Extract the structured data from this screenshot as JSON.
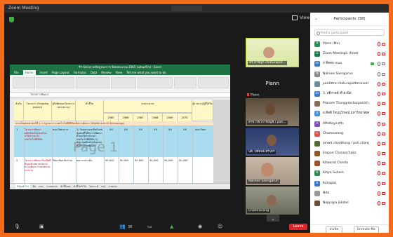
{
  "window": {
    "title": "Zoom Meeting"
  },
  "view": {
    "label": "View"
  },
  "excel": {
    "title": "รีวิวโครงการเชิงบูรณาการ ปีงบประมาณ 2565 (ฉบับแก้ไข) - Excel",
    "tabs": [
      "File",
      "Home",
      "Insert",
      "Page Layout",
      "Formulas",
      "Data",
      "Review",
      "View",
      "Tell me what you want to do"
    ],
    "active_tab": "Home",
    "formula": {
      "cell": "",
      "value": "โครงการพัฒนา"
    },
    "headers": [
      "ลำดับ",
      "โครงการ (Flagship project)",
      "ผู้รับผิดชอบโครงการ (หน่วยงาน)",
      "ตัวชี้วัด",
      "งบประมาณ",
      "ผู้รายงาน/ผู้ที่ได้รับ"
    ],
    "years": [
      "2565",
      "2566",
      "2567",
      "2568",
      "2569",
      "2570"
    ],
    "section_row": "ประเด็นยุทธศาสตร์ที่ 1 การบูรณาการเทคโนโลยีดิจิทัลเพื่อการพัฒนา (Digital and AI Technology)",
    "row1": {
      "num": "1",
      "project": "โครงการพัฒนาผลิตภัณฑ์ชุมชนด้วยนวัตกรรมและเทคโนโลยีดิจิทัล",
      "owner": "คณะวิทยาการ",
      "indicator": "1) ร้อยละของผลิตภัณฑ์ชุมชนที่ได้รับการพัฒนาด้วยนวัตกรรมและเทคโนโลยีดิจิทัล 2) จำนวนผลิตภัณฑ์ชุมชนที่ได้รับการพัฒนา",
      "values": [
        "XX",
        "XX",
        "XX",
        "XX",
        "XX",
        "XX"
      ],
      "reporter": "คณะวิทยา"
    },
    "row2": {
      "num": "2",
      "project": "โครงการพัฒนาบัณฑิตที่มีคุณลักษณะตรงตามความต้องการของตลาดแรงงาน",
      "owner": "วิทยาลัยนวัตกรรม",
      "indicator": "ผลการประเมิน",
      "values": [
        "90,000",
        "90,000",
        "90,000",
        "90,000",
        "90,000",
        "90,000"
      ]
    },
    "watermark": "Page 1",
    "sheet_tabs": [
      "ข้อมูลทั่วไป",
      "ฟิล",
      "กณะ",
      "ระบบตรวจ",
      "ตัวชี้วัดผล",
      "ตัวชี้วัดทั่วไป",
      "วิเคราะห์",
      "สรุป",
      "ภาพรวม"
    ],
    "active_sheet": "ข้อมูลทั่วไป"
  },
  "tiles": [
    {
      "label": "ดร.ป้าชญา chaturapat...",
      "speaking": true
    },
    {
      "name_big": "Plann",
      "label": "Plann"
    },
    {
      "label": "สาขาวิชาการบัญชี / poh..."
    },
    {
      "label": "นศ. ปีย์พันธ์ ศรีไตร"
    },
    {
      "label": "Nalinee Saengarun"
    },
    {
      "label": "Chamnarong"
    }
  ],
  "bottom_bar": {
    "mute_label": "Mute",
    "video_label": "Video",
    "participants_count": "38",
    "leave_label": "Leave"
  },
  "participants": {
    "title": "Participants (38)",
    "search_placeholder": "Find a participant",
    "list": [
      {
        "initials": "P",
        "color": "#2e8b57",
        "name": "Plann (Me)",
        "mic": "muted",
        "cam": "off"
      },
      {
        "initials": "Z",
        "color": "#1e7b4a",
        "name": "Zoom Meeting1 (Host)",
        "mic": "muted",
        "cam": "off"
      },
      {
        "initials": "4s",
        "color": "#3a78c6",
        "name": "4 ติดต่อ mua",
        "mic": "on",
        "cam": "on",
        "sharing": true
      },
      {
        "initials": "N",
        "color": "#888888",
        "name": "Nalinee Saengarun",
        "mic": "on",
        "cam": "on"
      },
      {
        "initials": "",
        "color": "#6b8e9f",
        "name": "pantittra chaturapattaranont",
        "mic": "muted",
        "cam": "off"
      },
      {
        "initials": "3s",
        "color": "#3a78c6",
        "name": "3. สติกาคต์ คำยวนิต",
        "mic": "muted",
        "cam": "off"
      },
      {
        "initials": "",
        "color": "#8a6d5a",
        "name": "Pranom Thangprecharpanich",
        "mic": "muted",
        "cam": "off"
      },
      {
        "initials": "อ",
        "color": "#4a90d9",
        "name": "อ.ศิตศิ ใจบุญวิกษณ์ มหาวิทยาลัยศรีฯ",
        "mic": "muted",
        "cam": "off"
      },
      {
        "initials": "A",
        "color": "#7b4fb8",
        "name": "Athittaya ตระ",
        "mic": "muted",
        "cam": "off"
      },
      {
        "initials": "C",
        "color": "#d9534f",
        "name": "Chamnarong",
        "mic": "muted",
        "cam": "off"
      },
      {
        "initials": "",
        "color": "#556b2f",
        "name": "janwit choothong / poh chang",
        "mic": "muted",
        "cam": "off"
      },
      {
        "initials": "",
        "color": "#8b5a2b",
        "name": "Jirapon Chananchaka",
        "mic": "muted",
        "cam": "off"
      },
      {
        "initials": "",
        "color": "#a0522d",
        "name": "Kitwarat Chinda",
        "mic": "muted",
        "cam": "off"
      },
      {
        "initials": "K",
        "color": "#2e8b57",
        "name": "Kitiya Suhem",
        "mic": "muted",
        "cam": "off"
      },
      {
        "initials": "K",
        "color": "#3a78c6",
        "name": "Kulrapas",
        "mic": "muted",
        "cam": "off"
      },
      {
        "initials": "",
        "color": "#999999",
        "name": "Nita",
        "mic": "muted",
        "cam": "off"
      },
      {
        "initials": "",
        "color": "#6b4f3a",
        "name": "Noppapa Julobol",
        "mic": "muted",
        "cam": "off"
      }
    ],
    "invite_label": "Invite",
    "unmute_me_label": "Unmute Me"
  }
}
